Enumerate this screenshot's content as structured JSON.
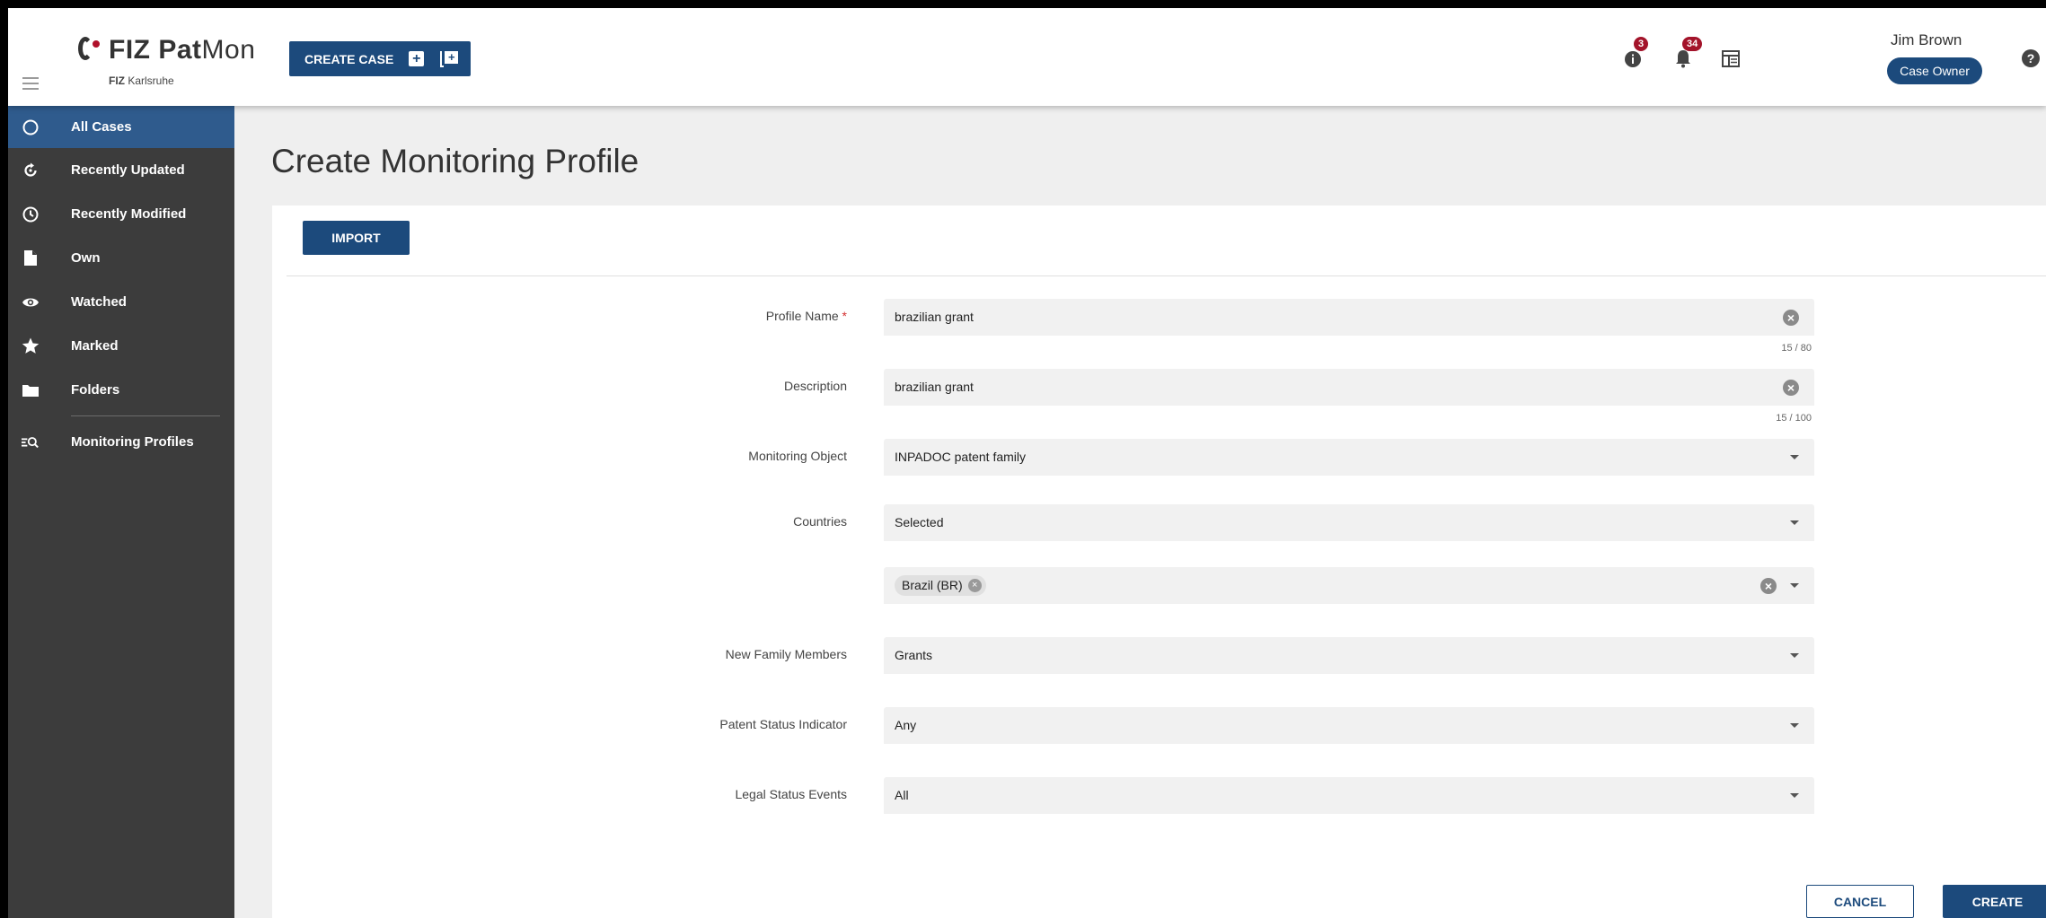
{
  "app": {
    "logo_brand": "FIZ",
    "logo_product_bold": "Pat",
    "logo_product_light": "Mon",
    "logo_sub_bold": "FIZ",
    "logo_sub": "Karlsruhe"
  },
  "header": {
    "create_case_label": "CREATE CASE",
    "info_badge": "3",
    "notifications_badge": "34",
    "user_name": "Jim Brown",
    "role_label": "Case Owner"
  },
  "sidebar": {
    "items": [
      {
        "label": "All Cases",
        "icon": "circle-icon"
      },
      {
        "label": "Recently Updated",
        "icon": "refresh-icon"
      },
      {
        "label": "Recently Modified",
        "icon": "clock-icon"
      },
      {
        "label": "Own",
        "icon": "document-icon"
      },
      {
        "label": "Watched",
        "icon": "eye-icon"
      },
      {
        "label": "Marked",
        "icon": "star-icon"
      },
      {
        "label": "Folders",
        "icon": "folder-icon"
      },
      {
        "label": "Monitoring Profiles",
        "icon": "monitoring-search-icon"
      }
    ],
    "active_item": "All Cases"
  },
  "page": {
    "title": "Create Monitoring Profile",
    "import_label": "IMPORT"
  },
  "form": {
    "profile_name": {
      "label": "Profile Name",
      "required_mark": "*",
      "value": "brazilian grant",
      "counter": "15 / 80"
    },
    "description": {
      "label": "Description",
      "value": "brazilian grant",
      "counter": "15 / 100"
    },
    "monitoring_object": {
      "label": "Monitoring Object",
      "value": "INPADOC patent family"
    },
    "countries": {
      "label": "Countries",
      "value": "Selected",
      "chips": [
        "Brazil (BR)"
      ]
    },
    "new_family_members": {
      "label": "New Family Members",
      "value": "Grants"
    },
    "patent_status_indicator": {
      "label": "Patent Status Indicator",
      "value": "Any"
    },
    "legal_status_events": {
      "label": "Legal Status Events",
      "value": "All"
    }
  },
  "actions": {
    "cancel_label": "CANCEL",
    "create_label": "CREATE"
  },
  "colors": {
    "primary": "#1c4a7c",
    "sidebar_bg": "#3c3c3c",
    "sidebar_active": "#2f5b8d",
    "badge": "#a3132a"
  }
}
